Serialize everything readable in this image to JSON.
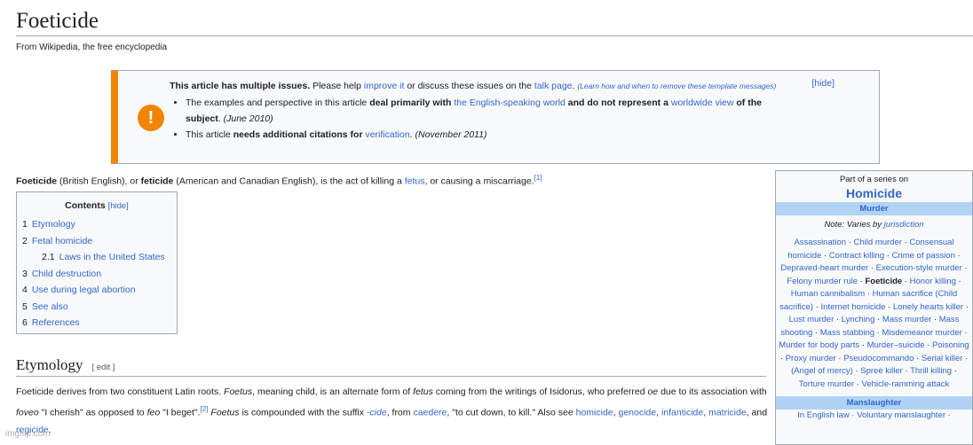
{
  "page": {
    "title": "Foeticide",
    "tagline": "From Wikipedia, the free encyclopedia"
  },
  "issues": {
    "heading": "This article has multiple issues.",
    "help_pre": "Please help",
    "improve_link": "improve it",
    "help_mid": "or discuss these issues on the",
    "talk_link": "talk page",
    "learn_link": "(Learn how and when to remove these template messages)",
    "hide": "[hide]",
    "icon_glyph": "!",
    "items": [
      {
        "t1": "The examples and perspective in this article",
        "b1": "deal primarily with",
        "l1": "the English-speaking world",
        "b2": "and do not represent a",
        "l2": "worldwide view",
        "b3": "of the subject",
        "date": "(June 2010)"
      },
      {
        "t1": "This article",
        "b1": "needs additional citations for",
        "l1": "verification",
        "date": "(November 2011)"
      }
    ]
  },
  "lead": {
    "b1": "Foeticide",
    "t1": "(British English), or",
    "b2": "feticide",
    "t2": "(American and Canadian English), is the act of killing a",
    "l1": "fetus",
    "t3": ", or causing a miscarriage.",
    "ref": "[1]"
  },
  "toc": {
    "title": "Contents",
    "hide": "[hide]",
    "items": [
      {
        "num": "1",
        "label": "Etymology"
      },
      {
        "num": "2",
        "label": "Fetal homicide"
      },
      {
        "num": "2.1",
        "label": "Laws in the United States"
      },
      {
        "num": "3",
        "label": "Child destruction"
      },
      {
        "num": "4",
        "label": "Use during legal abortion"
      },
      {
        "num": "5",
        "label": "See also"
      },
      {
        "num": "6",
        "label": "References"
      }
    ]
  },
  "etymology": {
    "heading": "Etymology",
    "edit": "[ edit ]",
    "p1": "Foeticide derives from two constituent Latin roots.",
    "i1": "Foetus",
    "p2": ", meaning child, is an alternate form of",
    "i2": "fetus",
    "p3": "coming from the writings of Isidorus, who preferred",
    "i3": "oe",
    "p4": "due to its association with",
    "i4": "foveo",
    "p5": "\"I cherish\" as opposed to",
    "i5": "feo",
    "p6": "\"I beget\".",
    "ref": "[2]",
    "i6": "Foetus",
    "p7": "is compounded with the suffix",
    "l_cide": "-cide",
    "p8": ", from",
    "l_caedere": "caedere",
    "p9": ", \"to cut down, to kill.\" Also see",
    "l_homicide": "homicide",
    "l_genocide": "genocide",
    "l_infanticide": "infanticide",
    "l_matricide": "matricide",
    "and": ", and",
    "l_regicide": "regicide",
    "end": "."
  },
  "sidebar": {
    "pre": "Part of a series on",
    "title": "Homicide",
    "murder_head": "Murder",
    "note_pre": "Note: Varies by",
    "note_link": "jurisdiction",
    "murder_items": [
      "Assassination",
      "Child murder",
      "Consensual homicide",
      "Contract killing",
      "Crime of passion",
      "Depraved-heart murder",
      "Execution-style murder",
      "Felony murder rule",
      "Foeticide",
      "Honor killing",
      "Human cannibalism",
      "Human sacrifice (Child sacrifice)",
      "Internet homicide",
      "Lonely hearts killer",
      "Lust murder",
      "Lynching",
      "Mass murder",
      "Mass shooting",
      "Mass stabbing",
      "Misdemeanor murder",
      "Murder for body parts",
      "Murder–suicide",
      "Poisoning",
      "Proxy murder",
      "Pseudocommando",
      "Serial killer",
      "(Angel of mercy)",
      "Spree killer",
      "Thrill killing",
      "Torture murder",
      "Vehicle-ramming attack"
    ],
    "manslaughter_head": "Manslaughter",
    "manslaughter_line": "In English law · Voluntary manslaughter ·"
  },
  "watermark": "imgflip.com"
}
